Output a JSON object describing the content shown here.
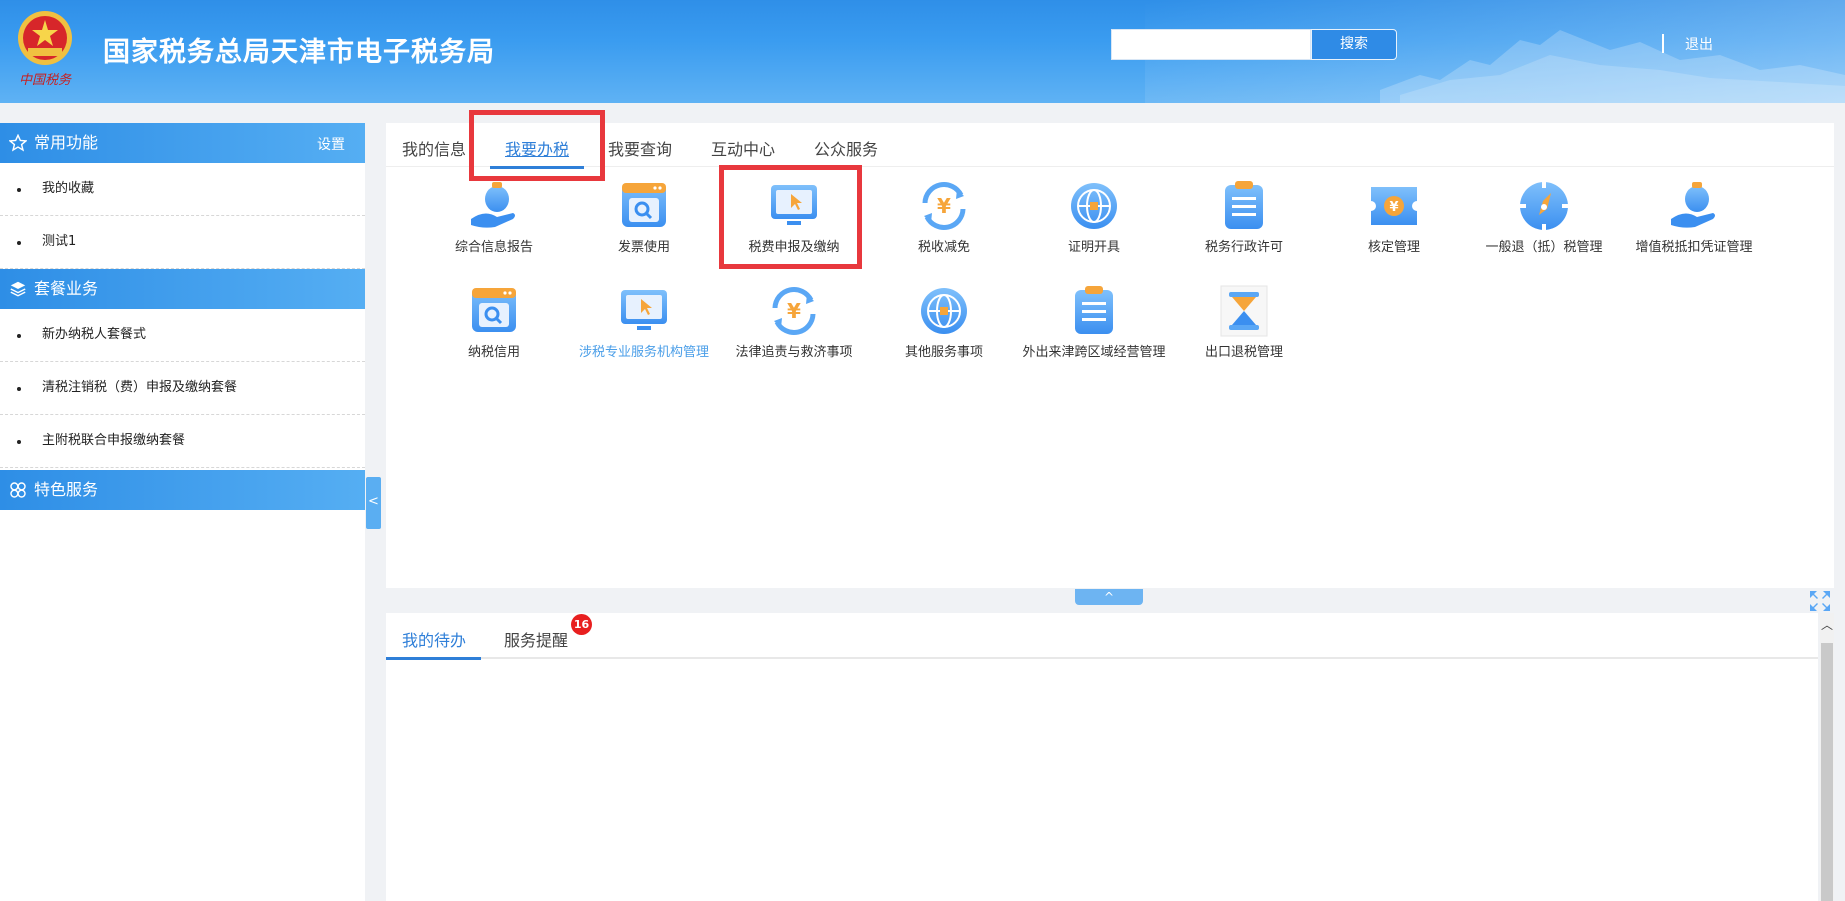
{
  "header": {
    "title": "国家税务总局天津市电子税务局",
    "emblem_caption": "中国税务",
    "search_placeholder": "",
    "search_button": "搜索",
    "logout": "退出"
  },
  "sidebar": {
    "sections": [
      {
        "title": "常用功能",
        "action": "设置",
        "items": [
          "我的收藏",
          "测试1"
        ]
      },
      {
        "title": "套餐业务",
        "items": [
          "新办纳税人套餐式",
          "清税注销税（费）申报及缴纳套餐",
          "主附税联合申报缴纳套餐"
        ]
      },
      {
        "title": "特色服务",
        "items": []
      }
    ],
    "collapse_label": "<"
  },
  "tabs": [
    "我的信息",
    "我要办税",
    "我要查询",
    "互动中心",
    "公众服务"
  ],
  "active_tab": "我要办税",
  "services": [
    {
      "label": "综合信息报告",
      "icon": "money-bag-hand-icon"
    },
    {
      "label": "发票使用",
      "icon": "search-browser-icon"
    },
    {
      "label": "税费申报及缴纳",
      "icon": "monitor-cursor-icon"
    },
    {
      "label": "税收减免",
      "icon": "yuan-refresh-icon"
    },
    {
      "label": "证明开具",
      "icon": "globe-icon"
    },
    {
      "label": "税务行政许可",
      "icon": "clipboard-icon"
    },
    {
      "label": "核定管理",
      "icon": "yuan-ticket-icon"
    },
    {
      "label": "一般退（抵）税管理",
      "icon": "compass-icon"
    },
    {
      "label": "增值税抵扣凭证管理",
      "icon": "money-bag-hand-icon"
    },
    {
      "label": "纳税信用",
      "icon": "search-browser-icon"
    },
    {
      "label": "涉税专业服务机构管理",
      "icon": "monitor-cursor-icon"
    },
    {
      "label": "法律追责与救济事项",
      "icon": "yuan-refresh-icon"
    },
    {
      "label": "其他服务事项",
      "icon": "globe-icon"
    },
    {
      "label": "外出来津跨区域经营管理",
      "icon": "clipboard-icon"
    },
    {
      "label": "出口退税管理",
      "icon": "hourglass-icon"
    }
  ],
  "expand_label": "^",
  "bottom_tabs": [
    "我的待办",
    "服务提醒"
  ],
  "reminder_count": "16",
  "colors": {
    "primary": "#2f8be6",
    "highlight": "#e8383d",
    "badge": "#e81f1f",
    "link": "#4a9ee8"
  }
}
